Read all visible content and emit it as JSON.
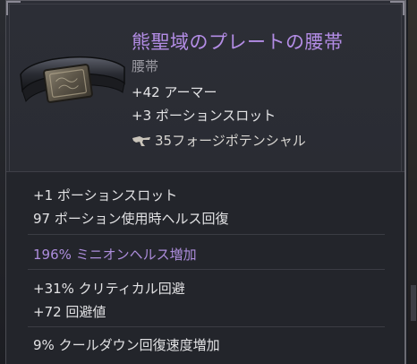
{
  "item": {
    "name": "熊聖域のプレートの腰帯",
    "type": "腰帯",
    "implicits": [
      "+42 アーマー",
      "+3 ポーションスロット"
    ],
    "forge_potential": "35フォージポテンシャル",
    "icon": "belt-icon",
    "forge_icon": "hammer-icon"
  },
  "mods": {
    "group1": [
      "+1 ポーションスロット",
      "97 ポーション使用時ヘルス回復"
    ],
    "group2": [
      "196% ミニオンヘルス増加"
    ],
    "group3": [
      "+31% クリティカル回避",
      "+72 回避値"
    ],
    "group4": [
      "9% クールダウン回復速度増加"
    ]
  },
  "colors": {
    "title": "#b48de6",
    "subtype": "#9b9aa2",
    "standard": "#e2e2e4",
    "minion_mod": "#ad8ddc"
  }
}
